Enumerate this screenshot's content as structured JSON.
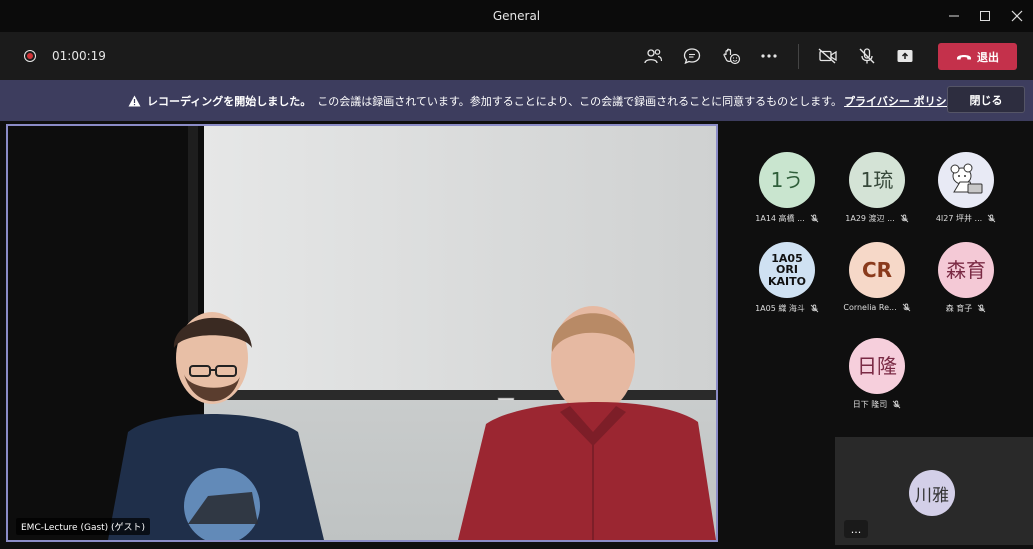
{
  "window": {
    "title": "General"
  },
  "toolbar": {
    "timer": "01:00:19",
    "leave_label": "退出"
  },
  "banner": {
    "bold_text": "レコーディングを開始しました。",
    "text": "この会議は録画されています。参加することにより、この会議で録画されることに同意するものとします。",
    "link": "プライバシー ポリシー",
    "close_label": "閉じる"
  },
  "stage": {
    "name": "EMC-Lecture (Gast) (ゲスト)"
  },
  "participants": [
    {
      "initials": "1う",
      "name": "1A14 高橋 ...",
      "color": "#c9e5cf",
      "text_color": "#2f5e3a",
      "muted": true
    },
    {
      "initials": "1琉",
      "name": "1A29 渡辺 ...",
      "color": "#d4e3d6",
      "text_color": "#36483a",
      "muted": true
    },
    {
      "initials": "",
      "name": "4I27 坪井 ...",
      "color": "#e8eaf5",
      "text_color": "#333333",
      "muted": true,
      "picture": "cartoon-avatar"
    },
    {
      "initials": "1A05\nORI\nKAITO",
      "name": "1A05 織 海斗",
      "color": "#cfe1f2",
      "text_color": "#111111",
      "muted": true
    },
    {
      "initials": "CR",
      "name": "Cornelia Re...",
      "color": "#f6d8c8",
      "text_color": "#8a3a1c",
      "muted": true
    },
    {
      "initials": "森育",
      "name": "森 育子",
      "color": "#f4c9d6",
      "text_color": "#7a2a44",
      "muted": true
    },
    {
      "initials": "日隆",
      "name": "日下 隆司",
      "color": "#f6cfdc",
      "text_color": "#7a2a44",
      "muted": true
    }
  ],
  "self_view": {
    "initials": "川雅",
    "more_label": "..."
  },
  "icons": {
    "record": "record-icon",
    "people": "people-icon",
    "chat": "chat-icon",
    "reactions": "reactions-icon",
    "more": "more-icon",
    "camera_off": "camera-off-icon",
    "mic_off": "mic-off-icon",
    "share": "share-icon",
    "leave": "phone-hangup-icon",
    "warning": "warning-icon"
  },
  "colors": {
    "leave_button": "#c4314b",
    "banner_bg": "#3d3d5e",
    "stage_border": "#8b8cc7",
    "recording": "#d13438"
  }
}
